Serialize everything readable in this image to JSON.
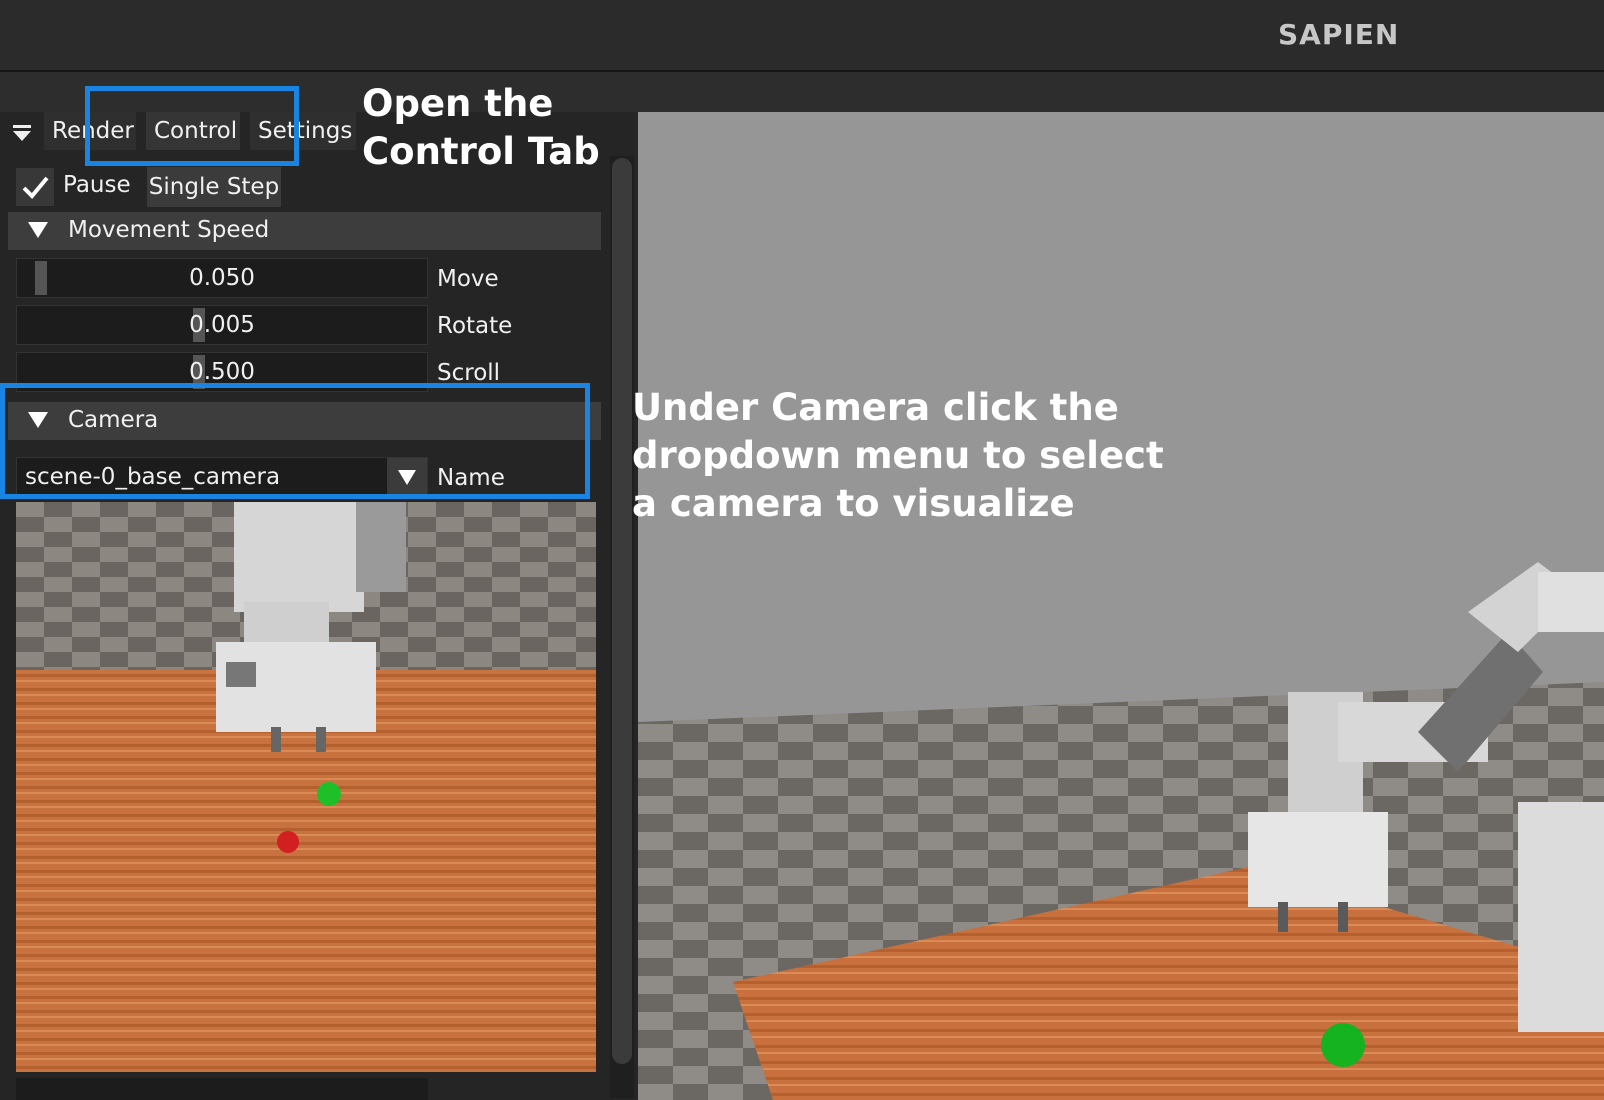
{
  "window": {
    "title": "SAPIEN"
  },
  "tabs": [
    {
      "label": "Render"
    },
    {
      "label": "Control"
    },
    {
      "label": "Settings"
    }
  ],
  "control": {
    "pause_label": "Pause",
    "pause_checked": true,
    "single_step_label": "Single Step"
  },
  "movement_speed": {
    "header": "Movement Speed",
    "sliders": [
      {
        "value": "0.050",
        "label": "Move"
      },
      {
        "value": "0.005",
        "label": "Rotate"
      },
      {
        "value": "0.500",
        "label": "Scroll"
      }
    ]
  },
  "camera": {
    "header": "Camera",
    "selected": "scene-0_base_camera",
    "dropdown_label": "Name"
  },
  "annotations": {
    "tab_hint": [
      "Open the",
      "Control Tab"
    ],
    "camera_hint": [
      "Under Camera click the",
      "dropdown menu to select",
      "a camera to visualize"
    ]
  },
  "colors": {
    "highlight": "#1a84e2",
    "panel_bg": "#252525",
    "viewport_sky": "#969696",
    "table_wood": "#c9713e"
  }
}
